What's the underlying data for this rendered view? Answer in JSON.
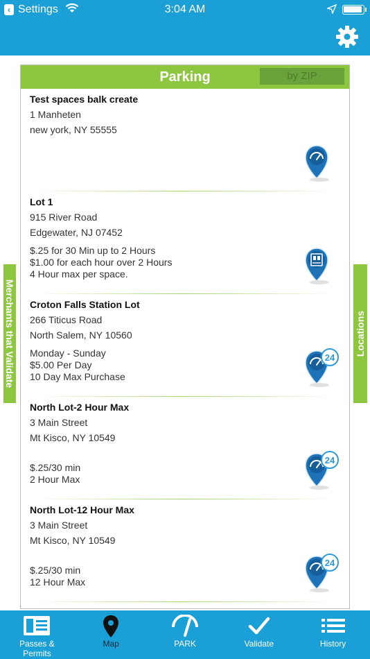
{
  "status_bar": {
    "back_app": "Settings",
    "time": "3:04 AM"
  },
  "header": {
    "settings_icon": "gear-icon"
  },
  "panel": {
    "title": "Parking",
    "zip_button": "by ZIP"
  },
  "side_tabs": {
    "left": "Merchants that Validate",
    "right": "Locations"
  },
  "locations": [
    {
      "name": "Test spaces balk create",
      "address": "1 Manheten",
      "city": "new york, NY 55555",
      "rates": [],
      "marker": "gauge-marker-icon"
    },
    {
      "name": "Lot 1",
      "address": "915 River Road",
      "city": "Edgewater, NJ 07452",
      "rates": [
        "$.25 for 30 Min up to 2 Hours",
        "$1.00 for each hour over 2 Hours",
        "4 Hour max per space."
      ],
      "marker": "pay-station-marker-icon"
    },
    {
      "name": "Croton Falls Station Lot",
      "address": "266 Titicus Road",
      "city": "North Salem, NY 10560",
      "rates": [
        "Monday - Sunday",
        "$5.00 Per Day",
        "10 Day Max Purchase"
      ],
      "marker": "gauge-24-marker-icon",
      "badge": "24"
    },
    {
      "name": "North Lot-2 Hour Max",
      "address": "3 Main Street",
      "city": "Mt Kisco, NY 10549",
      "rates": [
        "$.25/30 min",
        "2 Hour Max"
      ],
      "marker": "gauge-24-marker-icon",
      "badge": "24"
    },
    {
      "name": "North Lot-12 Hour Max",
      "address": "3 Main Street",
      "city": "Mt Kisco, NY 10549",
      "rates": [
        "$.25/30 min",
        "12 Hour Max"
      ],
      "marker": "gauge-24-marker-icon",
      "badge": "24"
    }
  ],
  "tabs": [
    {
      "label": "Passes &\nPermits",
      "icon": "passes-icon"
    },
    {
      "label": "Map",
      "icon": "map-pin-icon",
      "active": true
    },
    {
      "label": "PARK",
      "icon": "park-gauge-icon"
    },
    {
      "label": "Validate",
      "icon": "checkmark-icon"
    },
    {
      "label": "History",
      "icon": "list-icon"
    }
  ],
  "colors": {
    "header_blue": "#1a9fd6",
    "accent_green": "#8dc63f",
    "marker_blue": "#1e73b8"
  }
}
